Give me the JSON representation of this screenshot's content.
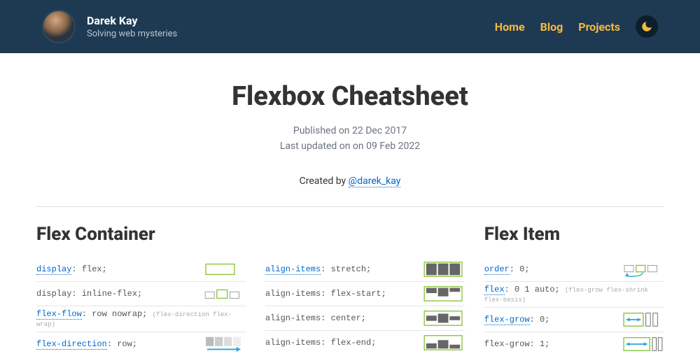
{
  "header": {
    "name": "Darek Kay",
    "tagline": "Solving web mysteries",
    "nav": {
      "home": "Home",
      "blog": "Blog",
      "projects": "Projects"
    }
  },
  "article": {
    "title": "Flexbox Cheatsheet",
    "published": "Published on 22 Dec 2017",
    "updated": "Last updated on on 09 Feb 2022",
    "created_prefix": "Created by ",
    "created_handle": "@darek_kay"
  },
  "left": {
    "heading": "Flex Container",
    "r1": {
      "prop": "display",
      "val": ": flex;"
    },
    "r2": {
      "prop": "display: inline-flex;"
    },
    "r3": {
      "prop": "flex-flow",
      "val": ": row nowrap;",
      "hint": "(flex-direction flex-wrap)"
    },
    "r4": {
      "prop": "flex-direction",
      "val": ": row;"
    }
  },
  "mid": {
    "r1": {
      "prop": "align-items",
      "val": ": stretch;"
    },
    "r2": {
      "prop": "align-items: flex-start;"
    },
    "r3": {
      "prop": "align-items: center;"
    },
    "r4": {
      "prop": "align-items: flex-end;"
    }
  },
  "right": {
    "heading": "Flex Item",
    "r1": {
      "prop": "order",
      "val": ": 0;"
    },
    "r2": {
      "prop": "flex",
      "val": ": 0 1 auto;",
      "hint": "(flex-grow flex-shrink flex-basis)"
    },
    "r3": {
      "prop": "flex-grow",
      "val": ": 0;"
    },
    "r4": {
      "prop": "flex-grow: 1;"
    }
  }
}
